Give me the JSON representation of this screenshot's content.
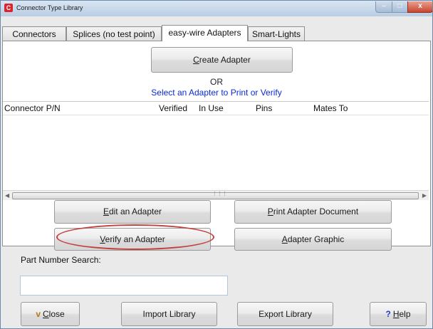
{
  "window": {
    "title": "Connector Type Library",
    "app_icon_letter": "C",
    "controls": {
      "minimize": "–",
      "maximize": "□",
      "close": "x"
    }
  },
  "tabs": [
    {
      "label": "Connectors",
      "active": false
    },
    {
      "label": "Splices (no test point)",
      "active": false
    },
    {
      "label": "easy-wire Adapters",
      "active": true
    },
    {
      "label": "Smart-Lights",
      "active": false
    }
  ],
  "panel": {
    "create_button": {
      "mnemonic": "C",
      "rest": "reate Adapter"
    },
    "or_text": "OR",
    "select_prompt": "Select an Adapter to Print or Verify"
  },
  "list": {
    "columns": [
      "Connector P/N",
      "Verified",
      "In Use",
      "Pins",
      "Mates To"
    ],
    "rows": []
  },
  "actions": {
    "edit": {
      "mnemonic": "E",
      "rest": "dit an Adapter"
    },
    "print": {
      "mnemonic": "P",
      "rest": "rint Adapter Document"
    },
    "verify": {
      "mnemonic": "V",
      "rest": "erify an Adapter"
    },
    "graphic": {
      "mnemonic": "A",
      "rest": "dapter Graphic"
    }
  },
  "search": {
    "label": "Part Number Search:",
    "value": "",
    "placeholder": ""
  },
  "footer": {
    "close": {
      "mnemonic": "C",
      "rest": "lose"
    },
    "import": "Import Library",
    "export": "Export Library",
    "help": {
      "mnemonic": "H",
      "rest": "elp"
    }
  },
  "colors": {
    "select_prompt": "#0b2bd4",
    "highlight": "#c4403d"
  },
  "icons": {
    "close": "exit-figure-icon",
    "help": "question-mark-icon"
  }
}
